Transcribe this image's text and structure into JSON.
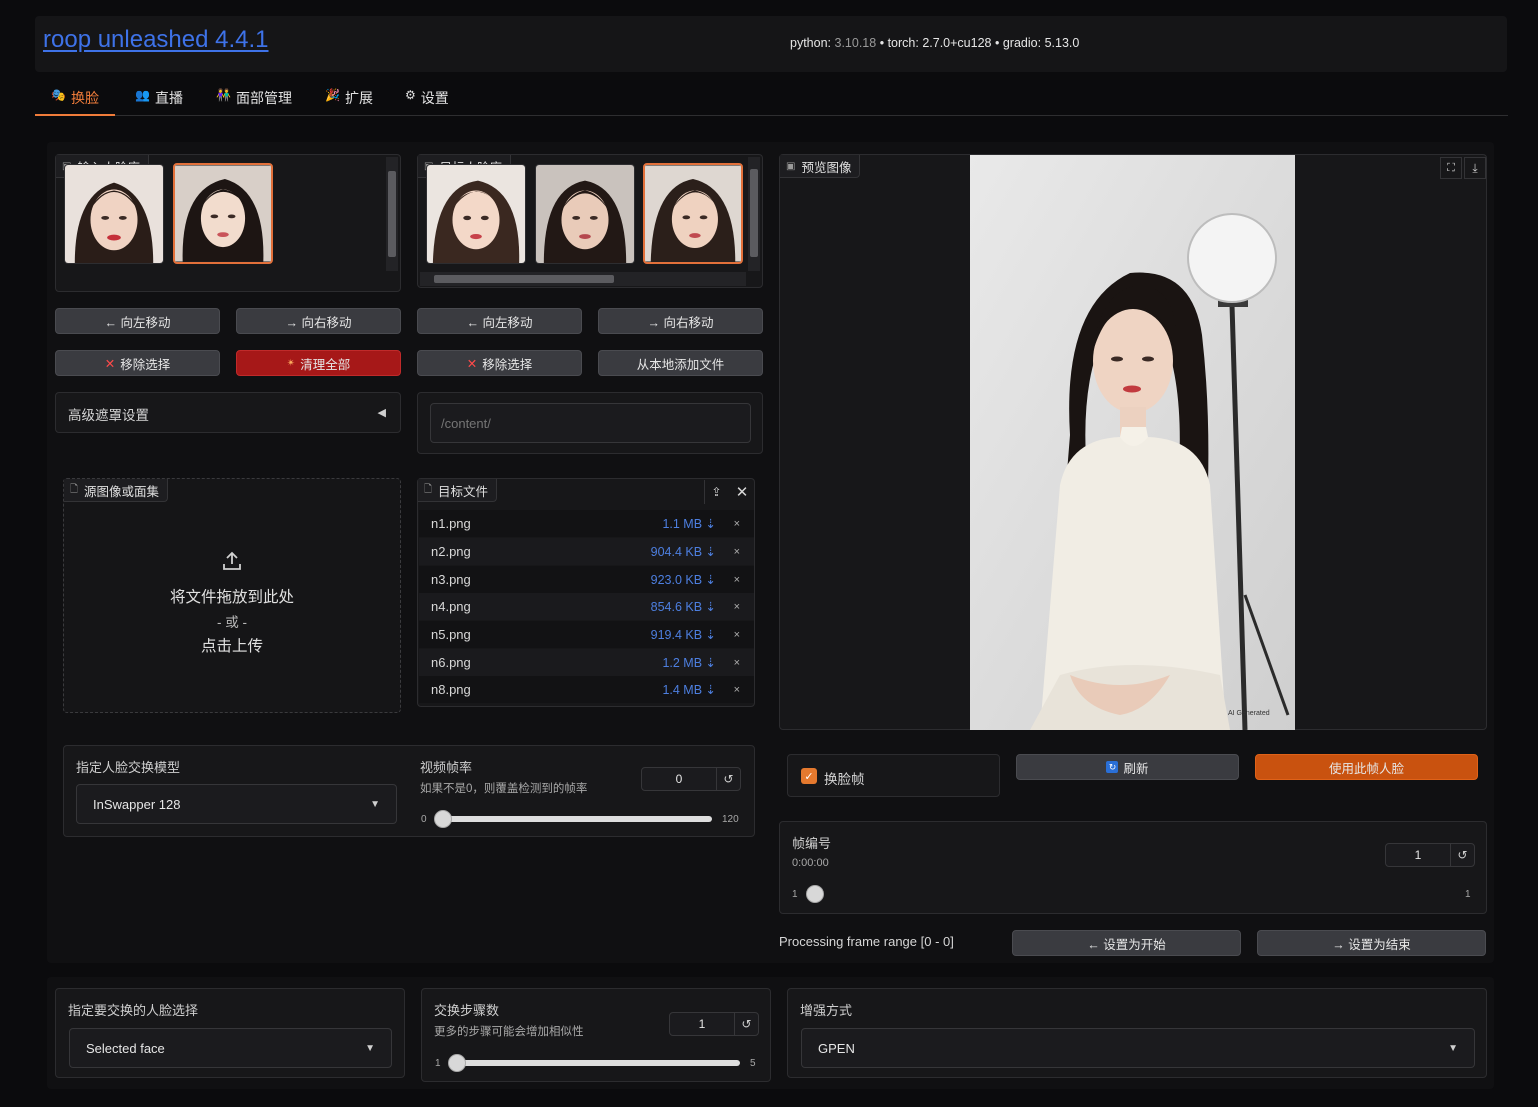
{
  "header": {
    "title": "roop unleashed 4.4.1",
    "python_label": "python:",
    "python_version": "3.10.18",
    "torch_label": "torch:",
    "torch_version": "2.7.0+cu128",
    "gradio_label": "gradio:",
    "gradio_version": "5.13.0",
    "sep": "•"
  },
  "tabs": [
    {
      "label": "换脸",
      "icon": "face-swap-icon",
      "active": true
    },
    {
      "label": "直播",
      "icon": "live-icon",
      "active": false
    },
    {
      "label": "面部管理",
      "icon": "face-management-icon",
      "active": false
    },
    {
      "label": "扩展",
      "icon": "extensions-icon",
      "active": false
    },
    {
      "label": "设置",
      "icon": "settings-gear-icon",
      "active": false,
      "glyph": "⚙"
    }
  ],
  "input_faces": {
    "label": "输入人脸库",
    "move_left": "← 向左移动",
    "move_right": "→ 向右移动",
    "remove_selected": "移除选择",
    "clear_all": "清理全部"
  },
  "target_faces": {
    "label": "目标人脸库",
    "move_left": "← 向左移动",
    "move_right": "→ 向右移动",
    "remove_selected": "移除选择",
    "add_local": "从本地添加文件"
  },
  "advanced_mask": {
    "label": "高级遮罩设置",
    "arrow": "◀"
  },
  "path_input": {
    "placeholder": "/content/"
  },
  "source_upload": {
    "label": "源图像或面集",
    "drop_text": "将文件拖放到此处",
    "or_text": "- 或 -",
    "click_text": "点击上传"
  },
  "target_files": {
    "label": "目标文件",
    "files": [
      {
        "name": "n1.png",
        "size": "1.1 MB ⇣"
      },
      {
        "name": "n2.png",
        "size": "904.4 KB ⇣"
      },
      {
        "name": "n3.png",
        "size": "923.0 KB ⇣"
      },
      {
        "name": "n4.png",
        "size": "854.6 KB ⇣"
      },
      {
        "name": "n5.png",
        "size": "919.4 KB ⇣"
      },
      {
        "name": "n6.png",
        "size": "1.2 MB ⇣"
      },
      {
        "name": "n8.png",
        "size": "1.4 MB ⇣"
      }
    ],
    "remove_glyph": "×"
  },
  "swap_model": {
    "label": "指定人脸交换模型",
    "value": "InSwapper 128"
  },
  "video_fps": {
    "label": "视频帧率",
    "sub": "如果不是0，则覆盖检测到的帧率",
    "value": "0",
    "min": "0",
    "max": "120",
    "level": 0
  },
  "preview": {
    "label": "预览图像",
    "watermark": "AI Generated"
  },
  "swap_frame": {
    "label": "换脸帧",
    "checked": true
  },
  "refresh_button": "刷新",
  "use_face_button": "使用此帧人脸",
  "frame_number": {
    "label": "帧编号",
    "time": "0:00:00",
    "value": "1",
    "min": "1",
    "max": "1",
    "level": 0
  },
  "frame_range": {
    "label": "Processing frame range [0 - 0]",
    "set_start": "← 设置为开始",
    "set_end": "→ 设置为结束"
  },
  "face_selection": {
    "label": "指定要交换的人脸选择",
    "value": "Selected face"
  },
  "swap_steps": {
    "label": "交换步骤数",
    "sub": "更多的步骤可能会增加相似性",
    "value": "1",
    "min": "1",
    "max": "5",
    "level": 0
  },
  "enhancer": {
    "label": "增强方式",
    "value": "GPEN"
  },
  "colors": {
    "accent_orange": "#f07c3a",
    "link_blue": "#3e72e8",
    "danger_red": "#a61818",
    "primary_orange": "#c9520f"
  }
}
